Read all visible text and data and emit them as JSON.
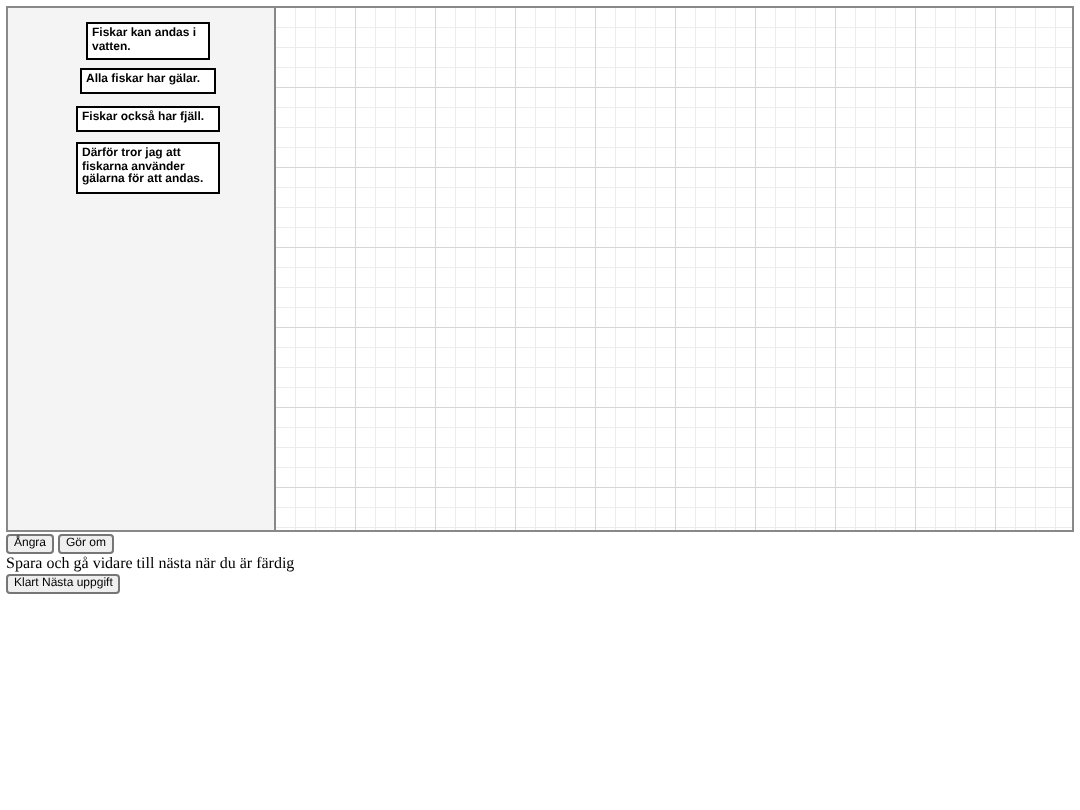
{
  "palette": {
    "nodes": [
      {
        "text": "Fiskar kan andas i vatten."
      },
      {
        "text": "Alla fiskar har gälar."
      },
      {
        "text": "Fiskar också har fjäll."
      },
      {
        "text": "Därför tror jag att fiskarna använder gälarna för att andas."
      }
    ]
  },
  "toolbar": [
    "Ångra",
    "Gör om"
  ],
  "instruction": "Spara och gå vidare till nästa när du är färdig",
  "next_button": "Klart Nästa uppgift"
}
